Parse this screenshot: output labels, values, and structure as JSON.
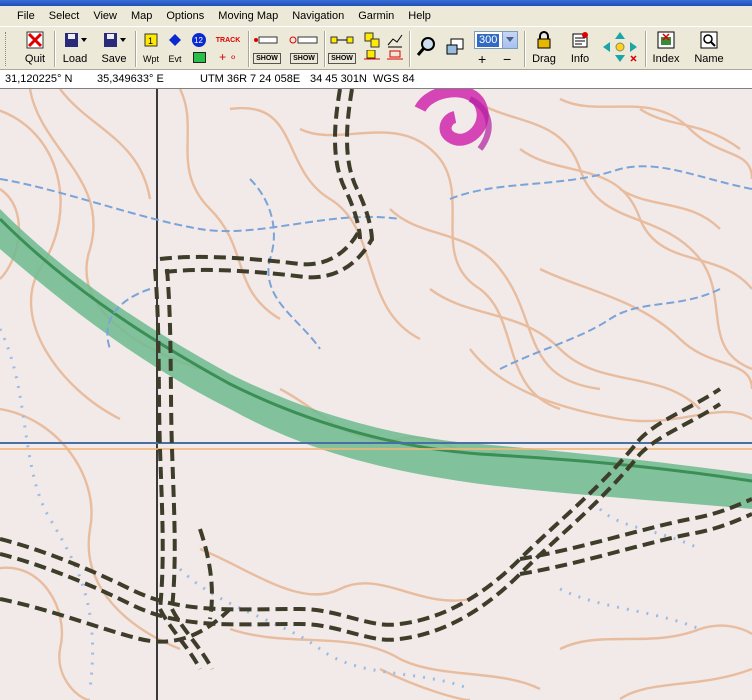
{
  "menu": [
    "File",
    "Select",
    "View",
    "Map",
    "Options",
    "Moving Map",
    "Navigation",
    "Garmin",
    "Help"
  ],
  "toolbar": {
    "quit": "Quit",
    "load": "Load",
    "save": "Save",
    "wpt": "Wpt",
    "evt": "Evt",
    "track_label": "TRACK",
    "show": "SHOW",
    "zoom_value": "300",
    "drag": "Drag",
    "info": "Info",
    "index": "Index",
    "name": "Name"
  },
  "status": {
    "lat": "31,120225° N",
    "lon": "35,349633° E",
    "utm": "UTM 36R",
    "easting": "7 24 058E",
    "northing": "34 45 301N",
    "datum": "WGS 84"
  },
  "colors": {
    "map_background": "#f1eae8",
    "contour": "#e8b898",
    "road": "#3d3d2a",
    "green_band": "#6dbb8f",
    "stream": "#7aa3d9",
    "magenta_feature": "#d645b5",
    "grid_line": "#4a6fa5",
    "menu_bg": "#ece9d8"
  }
}
